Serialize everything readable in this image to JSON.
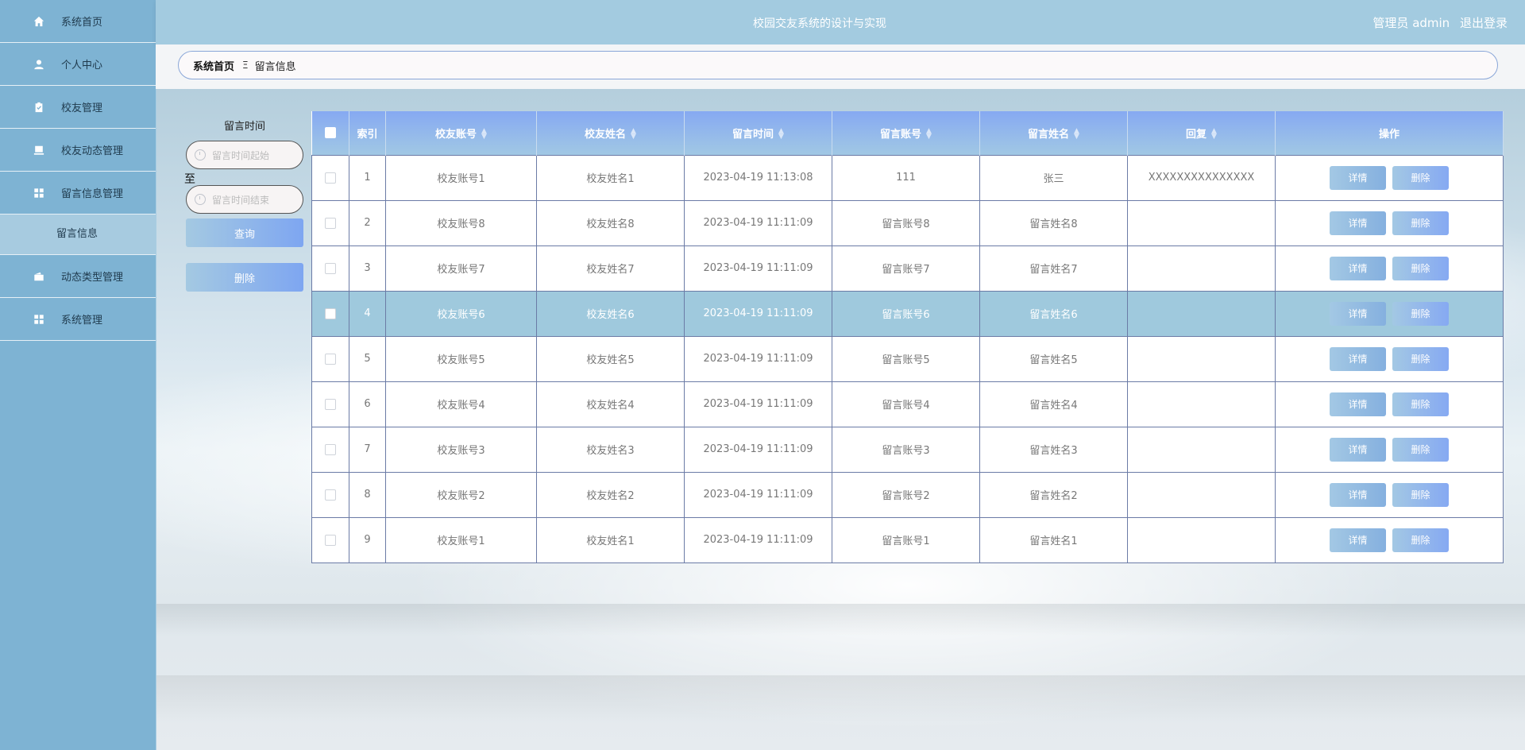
{
  "header": {
    "title": "校园交友系统的设计与实现",
    "user_label": "管理员 admin",
    "logout": "退出登录"
  },
  "sidebar": {
    "items": [
      {
        "label": "系统首页",
        "icon": "home-icon"
      },
      {
        "label": "个人中心",
        "icon": "user-icon"
      },
      {
        "label": "校友管理",
        "icon": "clipboard-icon"
      },
      {
        "label": "校友动态管理",
        "icon": "computer-icon"
      },
      {
        "label": "留言信息管理",
        "icon": "grid-icon"
      },
      {
        "label": "动态类型管理",
        "icon": "wallet-icon"
      },
      {
        "label": "系统管理",
        "icon": "grid-icon"
      }
    ],
    "submenu": {
      "label": "留言信息"
    }
  },
  "breadcrumb": {
    "home": "系统首页",
    "separator": "Ξ",
    "current": "留言信息"
  },
  "search": {
    "label": "留言时间",
    "start_placeholder": "留言时间起始",
    "to": "至",
    "end_placeholder": "留言时间结束",
    "query_button": "查询",
    "delete_button": "删除"
  },
  "table": {
    "columns": [
      "索引",
      "校友账号",
      "校友姓名",
      "留言时间",
      "留言账号",
      "留言姓名",
      "回复",
      "操作"
    ],
    "detail_label": "详情",
    "delete_label": "删除",
    "rows": [
      {
        "index": "1",
        "account": "校友账号1",
        "name": "校友姓名1",
        "time": "2023-04-19 11:13:08",
        "msg_account": "111",
        "msg_name": "张三",
        "reply": "XXXXXXXXXXXXXXX"
      },
      {
        "index": "2",
        "account": "校友账号8",
        "name": "校友姓名8",
        "time": "2023-04-19 11:11:09",
        "msg_account": "留言账号8",
        "msg_name": "留言姓名8",
        "reply": ""
      },
      {
        "index": "3",
        "account": "校友账号7",
        "name": "校友姓名7",
        "time": "2023-04-19 11:11:09",
        "msg_account": "留言账号7",
        "msg_name": "留言姓名7",
        "reply": ""
      },
      {
        "index": "4",
        "account": "校友账号6",
        "name": "校友姓名6",
        "time": "2023-04-19 11:11:09",
        "msg_account": "留言账号6",
        "msg_name": "留言姓名6",
        "reply": ""
      },
      {
        "index": "5",
        "account": "校友账号5",
        "name": "校友姓名5",
        "time": "2023-04-19 11:11:09",
        "msg_account": "留言账号5",
        "msg_name": "留言姓名5",
        "reply": ""
      },
      {
        "index": "6",
        "account": "校友账号4",
        "name": "校友姓名4",
        "time": "2023-04-19 11:11:09",
        "msg_account": "留言账号4",
        "msg_name": "留言姓名4",
        "reply": ""
      },
      {
        "index": "7",
        "account": "校友账号3",
        "name": "校友姓名3",
        "time": "2023-04-19 11:11:09",
        "msg_account": "留言账号3",
        "msg_name": "留言姓名3",
        "reply": ""
      },
      {
        "index": "8",
        "account": "校友账号2",
        "name": "校友姓名2",
        "time": "2023-04-19 11:11:09",
        "msg_account": "留言账号2",
        "msg_name": "留言姓名2",
        "reply": ""
      },
      {
        "index": "9",
        "account": "校友账号1",
        "name": "校友姓名1",
        "time": "2023-04-19 11:11:09",
        "msg_account": "留言账号1",
        "msg_name": "留言姓名1",
        "reply": ""
      }
    ]
  }
}
